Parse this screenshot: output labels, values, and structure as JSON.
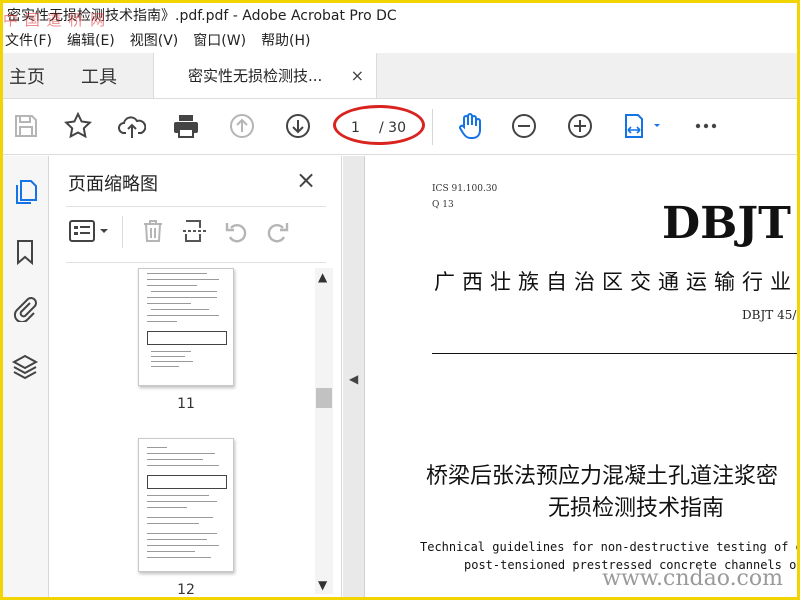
{
  "window": {
    "title": "密实性无损检测技术指南》.pdf.pdf - Adobe Acrobat Pro DC"
  },
  "watermarks": {
    "top": "中 国 道 桥 网",
    "bottom": "www.cndao.com"
  },
  "menu": [
    "文件(F)",
    "编辑(E)",
    "视图(V)",
    "窗口(W)",
    "帮助(H)"
  ],
  "tabs": {
    "home": "主页",
    "tools": "工具",
    "document": "密实性无损检测技...",
    "close": "×"
  },
  "toolbar": {
    "icons": [
      "save-icon",
      "star-icon",
      "upload-icon",
      "print-icon",
      "prev-page-icon",
      "next-page-icon",
      "hand-icon",
      "zoom-out-icon",
      "zoom-in-icon",
      "fit-page-icon",
      "more-icon"
    ],
    "current_page": "1",
    "total_pages": "/ 30",
    "accent": "#1473e6",
    "highlight_color": "#d9231f"
  },
  "left_rail": [
    "pages-icon",
    "bookmark-icon",
    "attachment-icon",
    "layers-icon"
  ],
  "thumbnail_panel": {
    "title": "页面缩略图",
    "close": "×",
    "thumbnails": [
      {
        "label": "11"
      },
      {
        "label": "12"
      }
    ]
  },
  "document": {
    "ics": "ICS 91.100.30",
    "q": "Q 13",
    "standard_prefix": "DBJT",
    "organization": "广西壮族自治区交通运输行业",
    "code": "DBJT 45/",
    "title_line1": "桥梁后张法预应力混凝土孔道注浆密",
    "title_line2": "无损检测技术指南",
    "english_line1": "Technical guidelines for non-destructive testing of grouting",
    "english_line2": "post-tensioned prestressed concrete channels of brid"
  }
}
